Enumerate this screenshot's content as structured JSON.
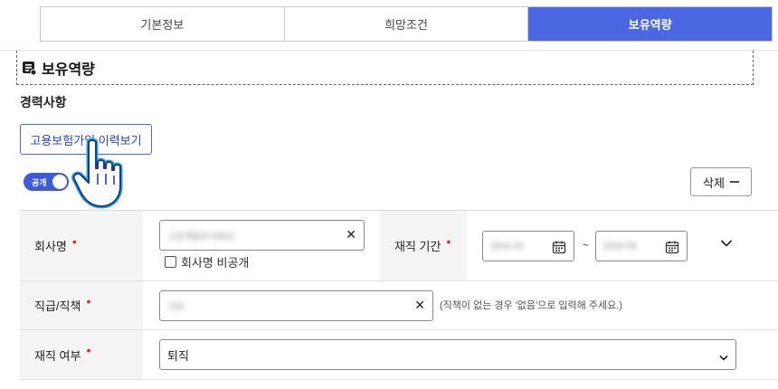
{
  "tabs": [
    {
      "label": "기본정보",
      "active": false
    },
    {
      "label": "희망조건",
      "active": false
    },
    {
      "label": "보유역량",
      "active": true
    }
  ],
  "section": {
    "title": "보유역량",
    "icon": "document-card-icon"
  },
  "career": {
    "title": "경력사항"
  },
  "history_button": {
    "label": "고용보험가입 이력보기"
  },
  "visibility_toggle": {
    "label": "공개",
    "on": true
  },
  "delete_button": {
    "label": "삭제",
    "icon": "minus-icon"
  },
  "form": {
    "company": {
      "label": "회사명",
      "value": "고유개발주식회사",
      "hide_label": "회사명 비공개",
      "hide_checked": false
    },
    "period": {
      "label": "재직 기간",
      "start": "2016-03",
      "separator": "~",
      "end": "2018-09"
    },
    "position": {
      "label": "직급/직책",
      "value": "기타",
      "hint": "(직책이 없는 경우 '없음'으로 입력해 주세요.)"
    },
    "employment_status": {
      "label": "재직 여부",
      "selected": "퇴직"
    }
  },
  "colors": {
    "accent": "#4a66e0",
    "required": "#e0223a",
    "label_bg": "#f4f4f4"
  }
}
